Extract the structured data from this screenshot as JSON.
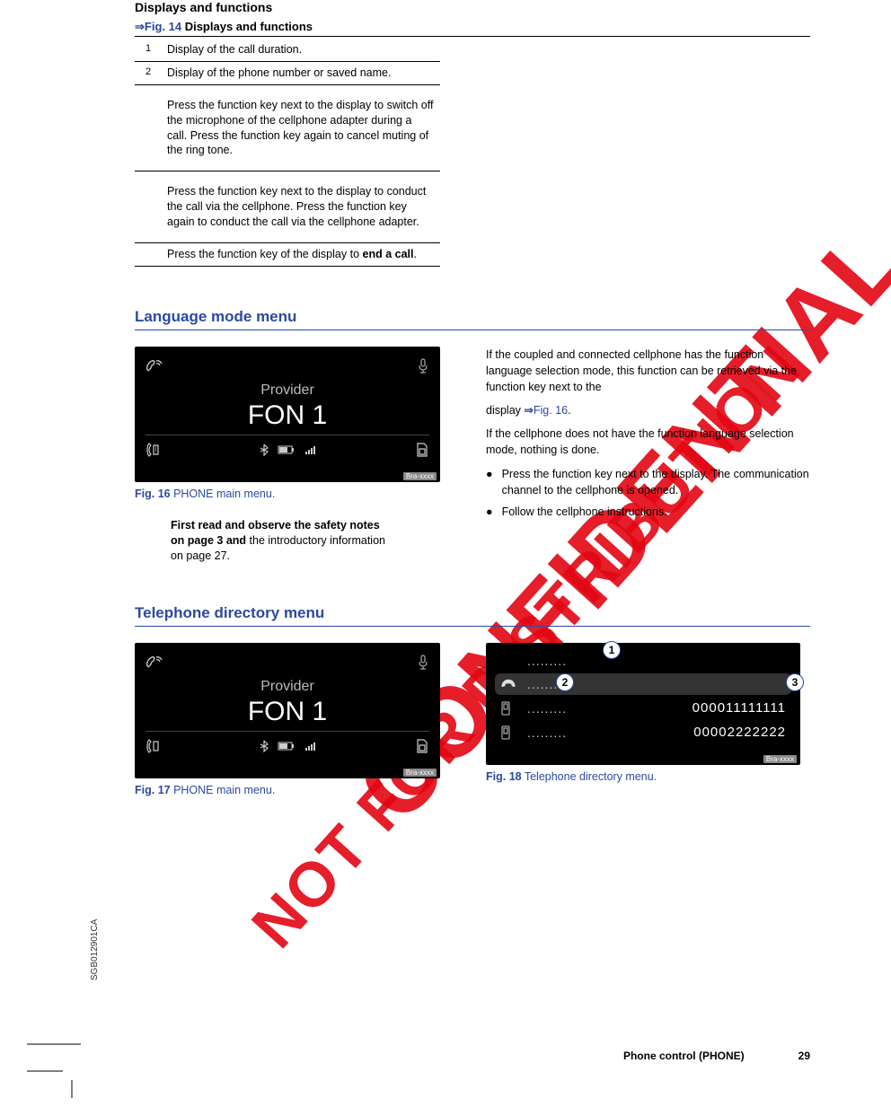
{
  "header": {
    "section_title": "Displays and functions",
    "table_caption_arrow": "⇒",
    "table_caption_figref": "Fig. 14",
    "table_caption_rest": " Displays and functions"
  },
  "func_table": [
    {
      "num": "1",
      "text": "Display of the call duration."
    },
    {
      "num": "2",
      "text": "Display of the phone number or saved name."
    },
    {
      "num": "",
      "text": "Press the function key next to the display to switch off the microphone of the cellphone adapter during a call. Press the function key again to cancel muting of the ring tone."
    },
    {
      "num": "",
      "text": "Press the function key next to the display to conduct the call via the cellphone. Press the function key again to conduct the call via the cellphone adapter."
    },
    {
      "num": "",
      "text_pre": "Press the ",
      "text_mid": " function key of the display to ",
      "text_bold": "end a call",
      "text_post": "."
    }
  ],
  "lang_section": {
    "title": "Language mode menu",
    "display": {
      "provider": "Provider",
      "fon": "FON 1",
      "icons_placeholder": ""
    },
    "fig_caption_num": "Fig. 16",
    "fig_caption_text": " PHONE main menu.",
    "safety_bold": "First read and observe the safety notes on page 3 and ",
    "safety_rest": "the introductory information on page 27.",
    "para1": "If the coupled and connected cellphone has the function language selection mode, this function can be retrieved via the function key next to the",
    "para1b_pre": "display   ",
    "para1b_arrow": "⇒",
    "para1b_fig": "Fig. 16",
    "para1b_post": ".",
    "para2": "If the cellphone does not have the function language selection mode, nothing is done.",
    "bullet1": "Press the function key next to the    display. The communication channel to the cellphone is opened.",
    "bullet2": "Follow the cellphone instructions."
  },
  "dir_section": {
    "title": "Telephone directory menu",
    "fig17_num": "Fig. 17",
    "fig17_text": " PHONE main menu.",
    "fig18_num": "Fig. 18",
    "fig18_text": " Telephone directory menu.",
    "display": {
      "provider": "Provider",
      "fon": "FON 1"
    },
    "dir_rows": [
      {
        "name": ".........",
        "num": ""
      },
      {
        "name": "........",
        "num": ""
      },
      {
        "name": ".........",
        "num": "000011111111"
      },
      {
        "name": ".........",
        "num": "00002222222"
      }
    ],
    "callouts": {
      "c1": "1",
      "c2": "2",
      "c3": "3"
    }
  },
  "footer": {
    "chapter": "Phone control (PHONE)",
    "page": "29"
  },
  "side_code": "SGB012901CA",
  "display_tag": "Bra-xxxx",
  "watermark1": "CONFIDENTIAL",
  "watermark2": "NOT FOR DISTRIBUTION"
}
